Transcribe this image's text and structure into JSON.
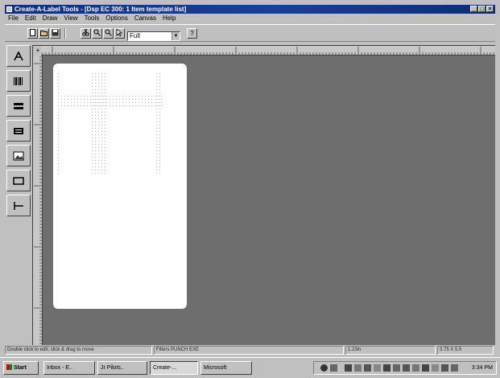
{
  "window": {
    "title": "Create-A-Label Tools - [Dsp EC 300: 1 Item template list]"
  },
  "menu": [
    "File",
    "Edit",
    "Draw",
    "View",
    "Tools",
    "Options",
    "Canvas",
    "Help"
  ],
  "toolbar": {
    "zoom_value": "Full",
    "help_label": "?"
  },
  "left_tools": [
    "text-tool",
    "barcode-tool",
    "bar-graphic-tool",
    "label-tool",
    "image-tool",
    "rectangle-tool",
    "line-tool"
  ],
  "canvas": {
    "corner_label": "+",
    "background_color": "#6e6e6e",
    "label_color": "#ffffff"
  },
  "statusbar": {
    "hint": "Double click to edit; click & drag to move",
    "name": "Filters PUNCH EXE",
    "position": "1.23in",
    "size": "3.75 X 5.5"
  },
  "taskbar": {
    "start": "Start",
    "buttons": [
      "Inbox - E..",
      "Jr Pilots..",
      "Create-...",
      "Microsoft"
    ],
    "active_index": 2,
    "clock": "3:34 PM"
  }
}
